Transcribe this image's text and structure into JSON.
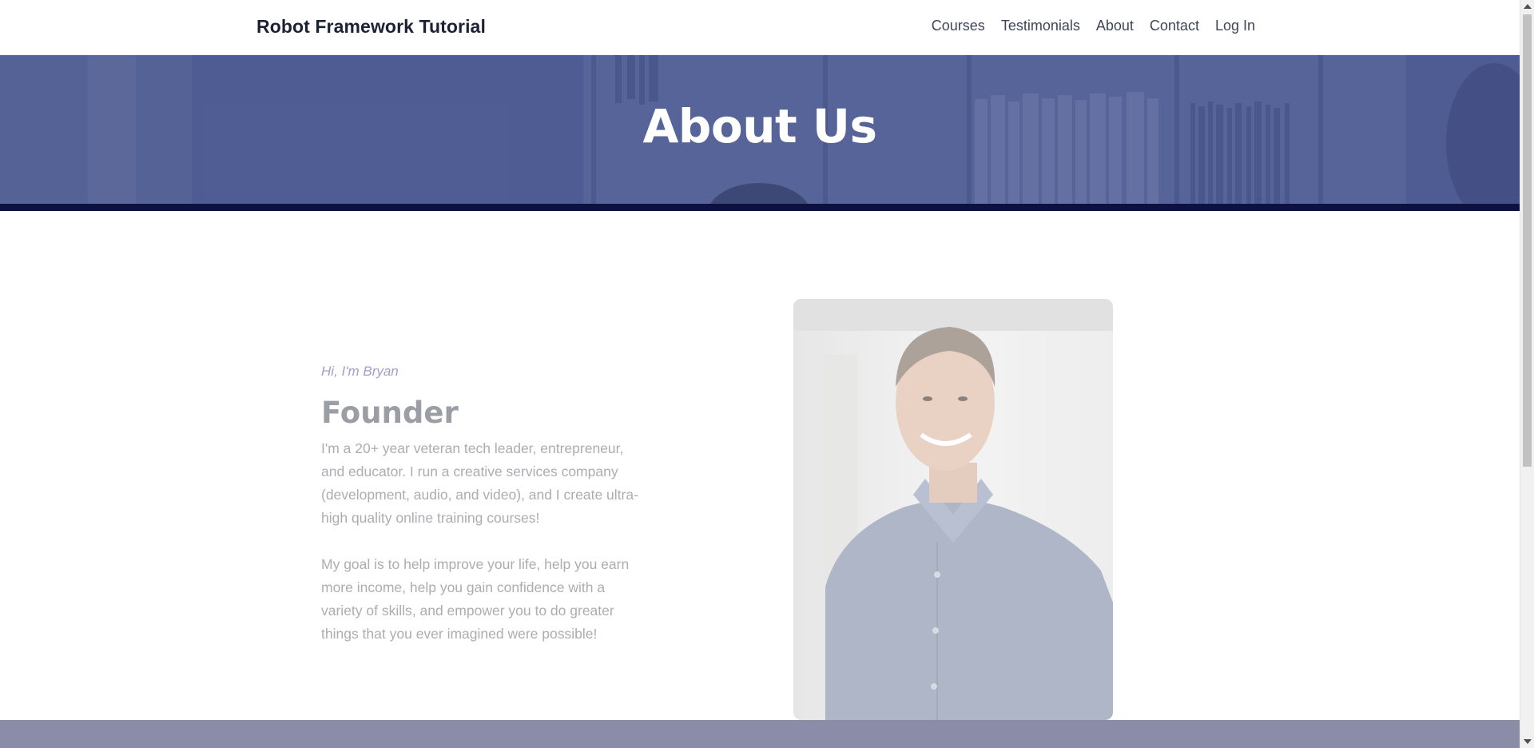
{
  "header": {
    "brand": "Robot Framework Tutorial",
    "nav": [
      {
        "label": "Courses"
      },
      {
        "label": "Testimonials"
      },
      {
        "label": "About"
      },
      {
        "label": "Contact"
      },
      {
        "label": "Log In"
      }
    ]
  },
  "hero": {
    "title": "About Us"
  },
  "about": {
    "greeting": "Hi, I'm Bryan",
    "role": "Founder",
    "paragraphs": [
      "I'm a 20+ year veteran tech leader, entrepreneur, and educator. I run a creative services company (development, audio, and video), and I create ultra-high quality online training courses!",
      "My goal is to help improve your life, help you earn more income, help you gain confidence with a variety of skills, and empower you to do greater things that you ever imagined were possible!"
    ]
  },
  "colors": {
    "hero_band": "#0c1140",
    "greeting": "#a39ccd",
    "footer_band": "#8a8ca8"
  }
}
